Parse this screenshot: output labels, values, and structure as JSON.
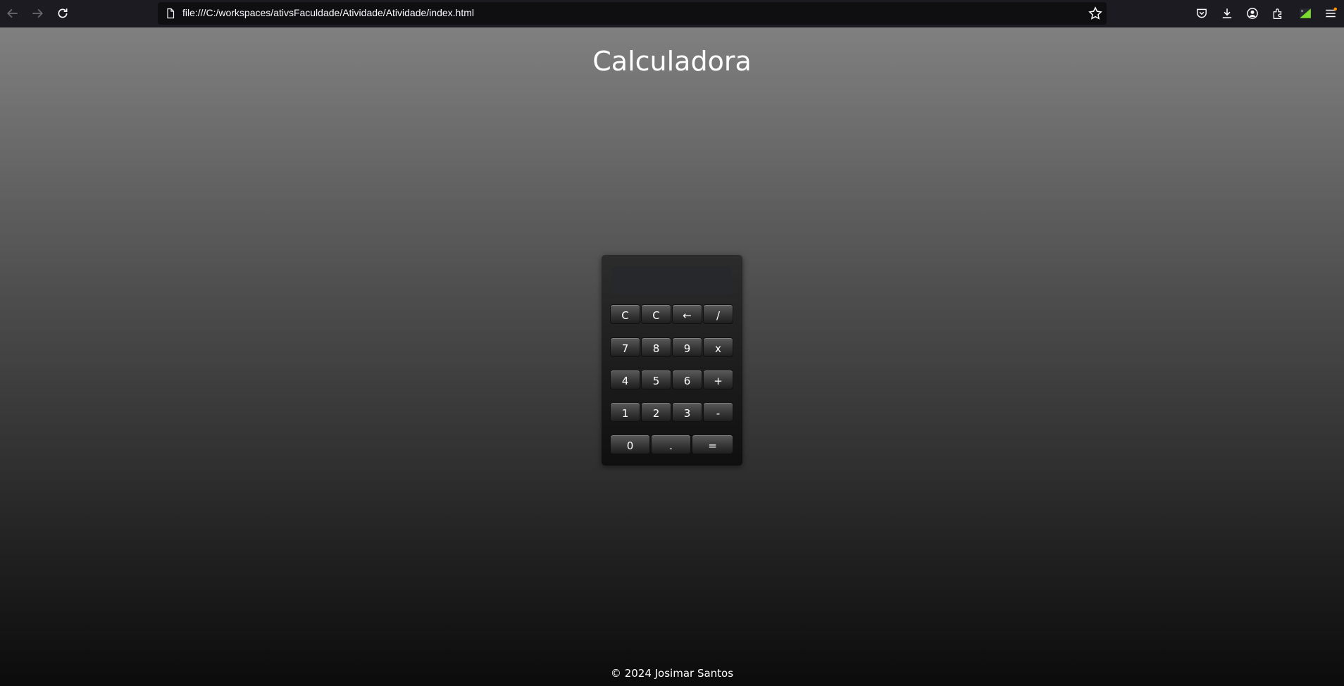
{
  "browser": {
    "url": "file:///C:/workspaces/ativsFaculdade/Atividade/Atividade/index.html",
    "icons": [
      "back-icon",
      "forward-icon",
      "reload-icon",
      "page-icon",
      "bookmark-star-icon",
      "pocket-icon",
      "downloads-icon",
      "account-icon",
      "extensions-icon",
      "extension-colored-icon",
      "menu-icon"
    ]
  },
  "page": {
    "title": "Calculadora",
    "footer": "© 2024 Josimar Santos"
  },
  "calculator": {
    "display_value": "",
    "rows": [
      [
        "C",
        "C",
        "←",
        "/"
      ],
      [
        "7",
        "8",
        "9",
        "x"
      ],
      [
        "4",
        "5",
        "6",
        "+"
      ],
      [
        "1",
        "2",
        "3",
        "-"
      ],
      [
        "0",
        ".",
        "="
      ]
    ]
  },
  "colors": {
    "toolbar_bg": "#1c1b22",
    "urlbar_bg": "#0f0f12",
    "page_gradient_top": "#808080",
    "page_gradient_bottom": "#0b0b0b",
    "calculator_bg": "#1a1a1a",
    "display_bg": "#27282b",
    "text": "#ffffff"
  }
}
